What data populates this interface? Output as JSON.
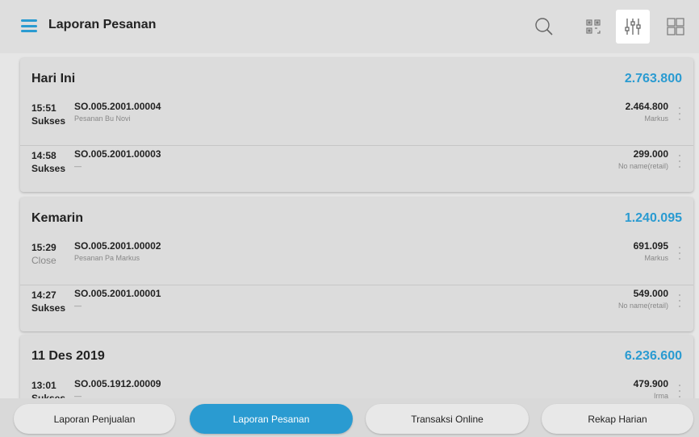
{
  "header": {
    "title": "Laporan Pesanan",
    "icons": [
      "menu-icon",
      "search-icon",
      "scan-icon",
      "filter-sliders-icon",
      "grid-icon"
    ]
  },
  "colors": {
    "accent": "#2a9bd1",
    "header_bg": "#dedede",
    "card_bg": "#dcdcdc"
  },
  "groups": [
    {
      "date": "Hari Ini",
      "total": "2.763.800",
      "orders": [
        {
          "time": "15:51",
          "status": "Sukses",
          "no": "SO.005.2001.00004",
          "note": "Pesanan Bu Novi",
          "amount": "2.464.800",
          "customer": "Markus"
        },
        {
          "time": "14:58",
          "status": "Sukses",
          "no": "SO.005.2001.00003",
          "note": "—",
          "amount": "299.000",
          "customer": "No name(retail)"
        }
      ]
    },
    {
      "date": "Kemarin",
      "total": "1.240.095",
      "orders": [
        {
          "time": "15:29",
          "status": "Close",
          "no": "SO.005.2001.00002",
          "note": "Pesanan Pa Markus",
          "amount": "691.095",
          "customer": "Markus"
        },
        {
          "time": "14:27",
          "status": "Sukses",
          "no": "SO.005.2001.00001",
          "note": "—",
          "amount": "549.000",
          "customer": "No name(retail)"
        }
      ]
    },
    {
      "date": "11 Des 2019",
      "total": "6.236.600",
      "orders": [
        {
          "time": "13:01",
          "status": "Sukses",
          "no": "SO.005.1912.00009",
          "note": "—",
          "amount": "479.900",
          "customer": "Irma"
        }
      ]
    }
  ],
  "tabs": [
    {
      "label": "Laporan Penjualan",
      "active": false
    },
    {
      "label": "Laporan Pesanan",
      "active": true
    },
    {
      "label": "Transaksi Online",
      "active": false
    },
    {
      "label": "Rekap Harian",
      "active": false
    }
  ]
}
